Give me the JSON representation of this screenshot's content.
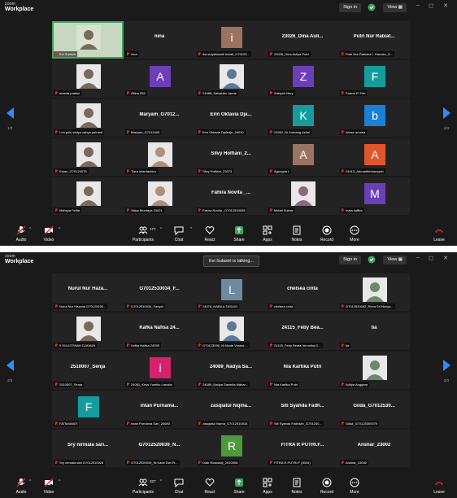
{
  "app": {
    "brand_top": "zoom",
    "brand_bottom": "Workplace",
    "sign_in": "Sign in",
    "view": "View"
  },
  "colors": {
    "green": "#3ba55c",
    "red": "#e02828",
    "blue": "#2d8cff"
  },
  "screen1": {
    "page_left": "1/3",
    "page_right": "1/3",
    "tiles": [
      {
        "kind": "photo",
        "label": "Evi Sulastri",
        "active": true
      },
      {
        "kind": "name",
        "name": "nina",
        "label": "nina"
      },
      {
        "kind": "avatar",
        "letter": "i",
        "color": "#9b7360",
        "label": "ika sulystiawati ismail_G70125..."
      },
      {
        "kind": "name",
        "name": "23026_Dina Auli...",
        "label": "23026_Dina Auliya Putri"
      },
      {
        "kind": "name",
        "name": "Putri Nur Rabiat...",
        "label": "Putri Nur Rabiatul I. Hamsiu_G..."
      },
      {
        "kind": "photo",
        "label": "ananta pratiwi"
      },
      {
        "kind": "avatar",
        "letter": "A",
        "color": "#6b3fb8",
        "label": "Alfina 952"
      },
      {
        "kind": "photo",
        "label": "24088_Salsabila Lande"
      },
      {
        "kind": "avatar",
        "letter": "Z",
        "color": "#6b3fb8",
        "label": "Zakiyah Nery"
      },
      {
        "kind": "avatar",
        "letter": "F",
        "color": "#159c9c",
        "label": "Faazul El Fitri"
      },
      {
        "kind": "photo",
        "label": "Luh putu widya cahya putranti"
      },
      {
        "kind": "name",
        "name": "Maryam_G7012...",
        "label": "Maryam_G7012405"
      },
      {
        "kind": "name",
        "name": "Erin Oktavia Dja...",
        "label": "Erin Oktavia Djaledje_24030"
      },
      {
        "kind": "avatar",
        "letter": "K",
        "color": "#159c9c",
        "label": "24062_Ni Komang Astini"
      },
      {
        "kind": "avatar",
        "letter": "b",
        "color": "#1a7fd6",
        "label": "baese amaria"
      },
      {
        "kind": "photo",
        "label": "Ersan_G70124076"
      },
      {
        "kind": "photo",
        "label": "Tiara intanfachira"
      },
      {
        "kind": "name",
        "name": "Silvy Holfiani_2...",
        "label": "Silvy Holfiani_23073"
      },
      {
        "kind": "avatar",
        "letter": "A",
        "color": "#9b7360",
        "label": "Agungria L"
      },
      {
        "kind": "avatar",
        "letter": "A",
        "color": "#e0552b",
        "label": "24013_Ahmadfebriansyah"
      },
      {
        "kind": "photo",
        "label": "Mahsya Felita"
      },
      {
        "kind": "photo",
        "label": "Siska Murdaya 23021"
      },
      {
        "kind": "name",
        "name": "Fahira Novita _...",
        "label": "Fahira Novita _G7012510005"
      },
      {
        "kind": "photo",
        "label": "Melati Sulma"
      },
      {
        "kind": "avatar",
        "letter": "M",
        "color": "#6b3fb8",
        "label": "maia saffira"
      }
    ],
    "participants_count": "177"
  },
  "screen2": {
    "speaking": "Evi Sulastri is talking...",
    "page_left": "2/3",
    "page_right": "2/3",
    "tiles": [
      {
        "kind": "name",
        "name": "Nurul Nur Haza...",
        "label": "Nurul Nur Hazana G70125100..."
      },
      {
        "kind": "name",
        "name": "G7012510034_F...",
        "label": "G7012510034_Fanyal"
      },
      {
        "kind": "avatar",
        "letter": "L",
        "color": "#6e8aa1",
        "label": "24076_NABILA TASLIM"
      },
      {
        "kind": "name",
        "name": "chelsea cinta",
        "label": "chelsea cinta"
      },
      {
        "kind": "photo",
        "label": "G7012520052_Reva Sri Novya..."
      },
      {
        "kind": "photo",
        "label": "9 SULISTINAH DJANUN"
      },
      {
        "kind": "name",
        "name": "Kafka Nafisa 24...",
        "label": "Kafka Nafisa 24099"
      },
      {
        "kind": "photo",
        "label": "G70123096_Ni Made Vinaca ..."
      },
      {
        "kind": "name",
        "name": "24115_Feby Bea...",
        "label": "24115_Feby Beata Veronika D..."
      },
      {
        "kind": "name",
        "name": "tia",
        "label": "tia"
      },
      {
        "kind": "name",
        "name": "2510007_Senja",
        "label": "2510007_Senja"
      },
      {
        "kind": "avatar",
        "letter": "i",
        "color": "#d6226b",
        "label": "24081_Keys Yumiko Lanotia"
      },
      {
        "kind": "name",
        "name": "24089_Nadya Sa...",
        "label": "24089_Nadya Sasmita Mahar..."
      },
      {
        "kind": "name",
        "name": "Nia Kartika Putri",
        "label": "Nia Kartika Putri"
      },
      {
        "kind": "photo",
        "label": "Aditya Anggara"
      },
      {
        "kind": "avatar",
        "letter": "F",
        "color": "#159c9c",
        "label": "FATMAWATI"
      },
      {
        "kind": "name",
        "name": "Intan Purnama...",
        "label": "Intan Purnama Sari_24080"
      },
      {
        "kind": "name",
        "name": "zasqiatul hiqma...",
        "label": "zasqiatul hiqma_G7012510016"
      },
      {
        "kind": "name",
        "name": "Siti Syahda Fadh...",
        "label": "Siti Syahda Fadhilah_G701240..."
      },
      {
        "kind": "name",
        "name": "Gilda_G7012530...",
        "label": "Gilda_G70125300079"
      },
      {
        "kind": "name",
        "name": "Sry nirmala sari...",
        "label": "Sry nirmala sari G7012510026"
      },
      {
        "kind": "name",
        "name": "G7012520039_N...",
        "label": "G7012520039_Ni Kade Dwi Fr..."
      },
      {
        "kind": "avatar",
        "letter": "R",
        "color": "#4e9a3a",
        "label": "Diah Rizawaty_2510008"
      },
      {
        "kind": "name",
        "name": "FITRA R PUTRI.F...",
        "label": "FITRA R PUTRI.F (3004)"
      },
      {
        "kind": "name",
        "name": "Anshar_23002",
        "label": "Anshar_23002"
      }
    ],
    "participants_count": "327"
  },
  "toolbar": {
    "audio": "Audio",
    "video": "Video",
    "participants": "Participants",
    "chat": "Chat",
    "react": "React",
    "share": "Share",
    "apps": "Apps",
    "notes": "Notes",
    "record": "Record",
    "more": "More",
    "leave": "Leave"
  }
}
